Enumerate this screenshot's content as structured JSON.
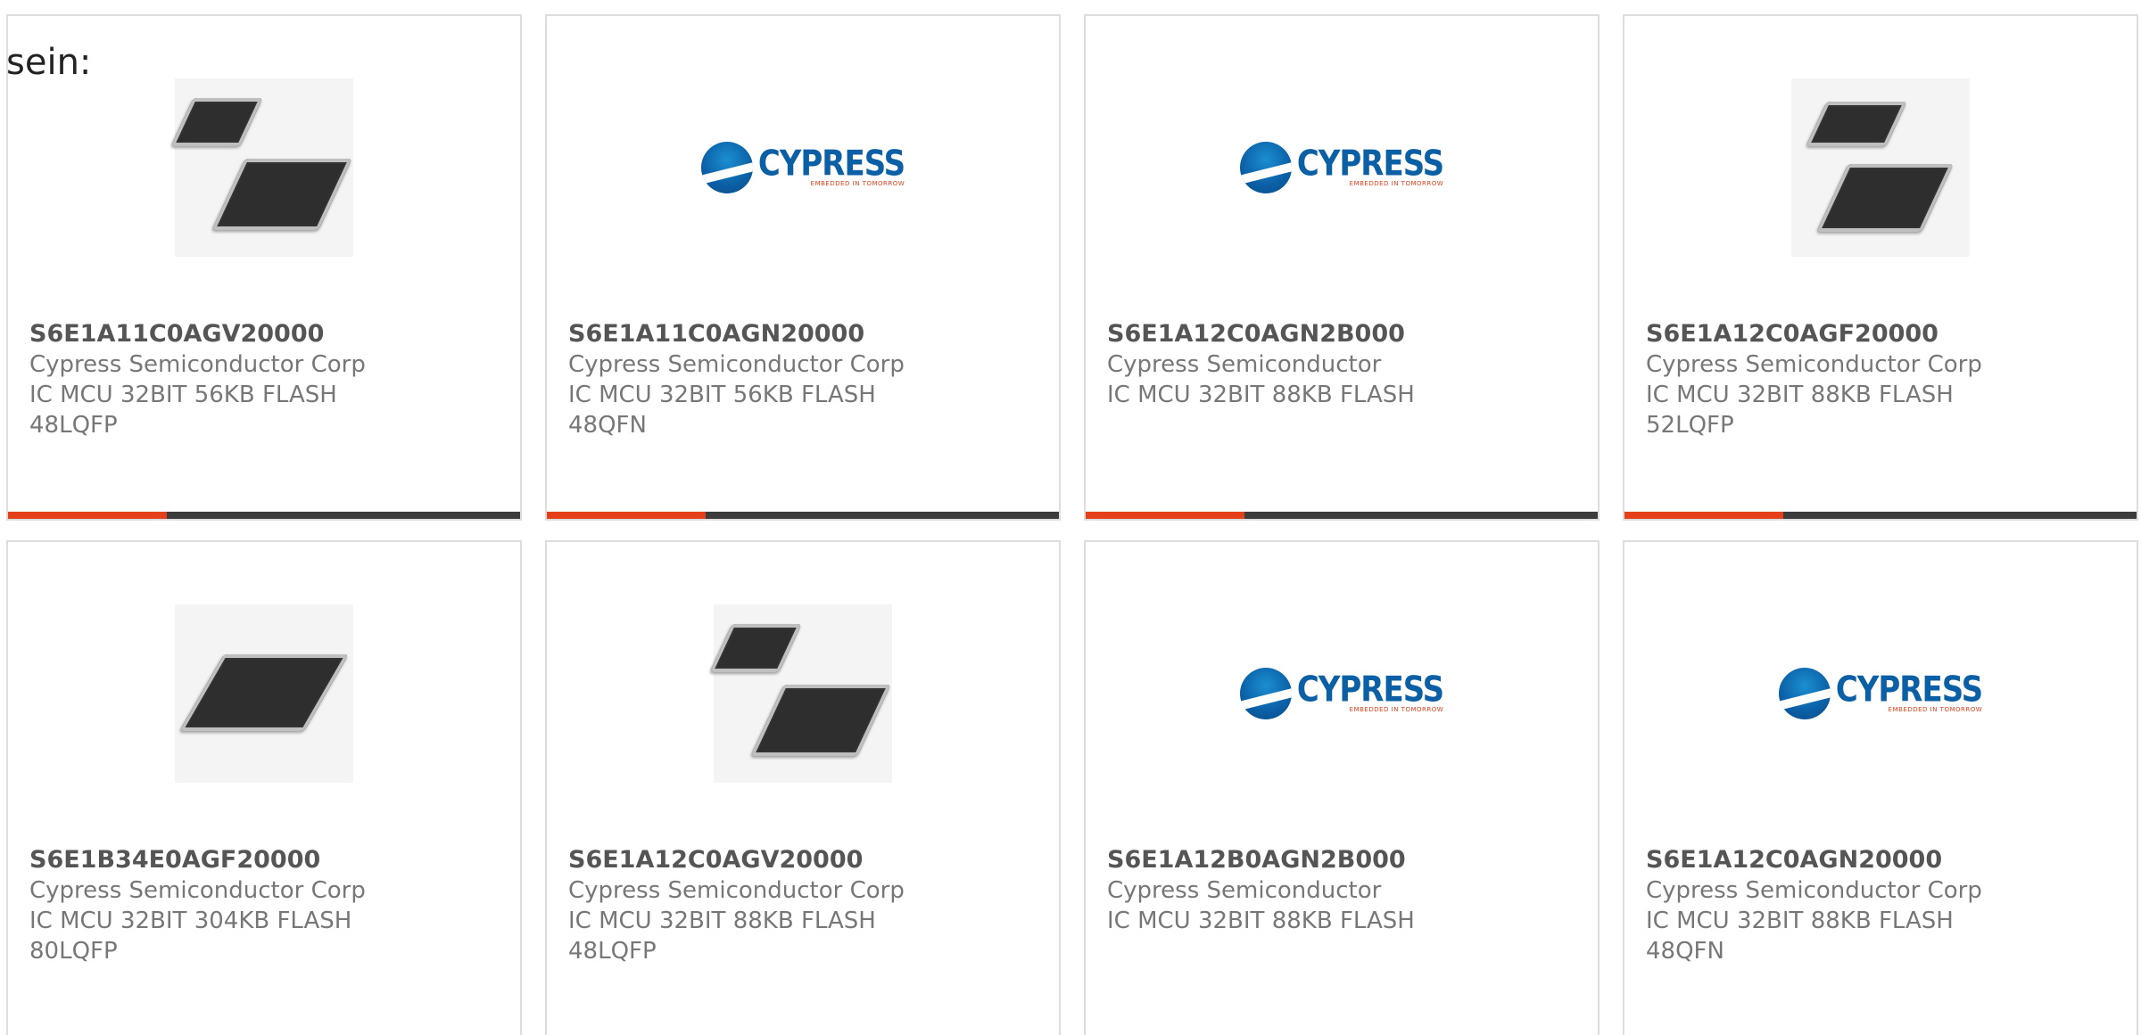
{
  "lead_text": "sein:",
  "logo": {
    "name": "CYPRESS",
    "tagline": "EMBEDDED IN TOMORROW"
  },
  "colors": {
    "accent": "#e4411b",
    "bar_track": "#3c3c3c",
    "brand_blue": "#0b5fa5"
  },
  "cards": [
    {
      "part_number": "S6E1A11C0AGV20000",
      "manufacturer": "Cypress Semiconductor Corp",
      "desc1": "IC MCU 32BIT 56KB FLASH",
      "desc2": "48LQFP",
      "image": "chip-pair-icon",
      "progress": 0.31
    },
    {
      "part_number": "S6E1A11C0AGN20000",
      "manufacturer": "Cypress Semiconductor Corp",
      "desc1": "IC MCU 32BIT 56KB FLASH",
      "desc2": "48QFN",
      "image": "cypress-logo",
      "progress": 0.31
    },
    {
      "part_number": "S6E1A12C0AGN2B000",
      "manufacturer": "Cypress Semiconductor",
      "desc1": "IC MCU 32BIT 88KB FLASH",
      "desc2": "",
      "image": "cypress-logo",
      "progress": 0.31
    },
    {
      "part_number": "S6E1A12C0AGF20000",
      "manufacturer": "Cypress Semiconductor Corp",
      "desc1": "IC MCU 32BIT 88KB FLASH",
      "desc2": "52LQFP",
      "image": "chip-pair-vertical-icon",
      "progress": 0.31
    },
    {
      "part_number": "S6E1B34E0AGF20000",
      "manufacturer": "Cypress Semiconductor Corp",
      "desc1": "IC MCU 32BIT 304KB FLASH",
      "desc2": "80LQFP",
      "image": "chip-single-icon",
      "progress": 0
    },
    {
      "part_number": "S6E1A12C0AGV20000",
      "manufacturer": "Cypress Semiconductor Corp",
      "desc1": "IC MCU 32BIT 88KB FLASH",
      "desc2": "48LQFP",
      "image": "chip-pair-icon",
      "progress": 0
    },
    {
      "part_number": "S6E1A12B0AGN2B000",
      "manufacturer": "Cypress Semiconductor",
      "desc1": "IC MCU 32BIT 88KB FLASH",
      "desc2": "",
      "image": "cypress-logo",
      "progress": 0
    },
    {
      "part_number": "S6E1A12C0AGN20000",
      "manufacturer": "Cypress Semiconductor Corp",
      "desc1": "IC MCU 32BIT 88KB FLASH",
      "desc2": "48QFN",
      "image": "cypress-logo",
      "progress": 0
    }
  ]
}
